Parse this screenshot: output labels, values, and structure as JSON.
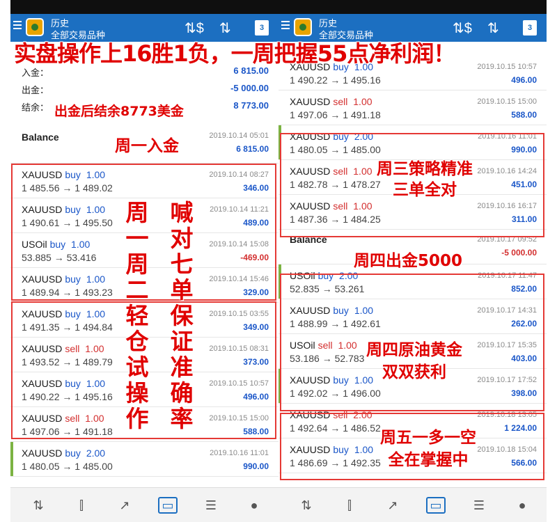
{
  "banner": "实盘操作上16胜1负，一周把握55点净利润！",
  "annotations": {
    "balance_note": "出金后结余8773美金",
    "monday_deposit": "周一入金",
    "mon_tue_col1": "周一周二轻仓试操作",
    "mon_tue_col2": "喊对七单保证准确率",
    "wednesday": "周三策略精准\n三单全对",
    "thursday_withdraw": "周四出金5000",
    "thursday_oil_gold": "周四原油黄金\n双双获利",
    "friday": "周五一多一空\n全在掌握中"
  },
  "appbar": {
    "title": "历史",
    "subtitle": "全部交易品种",
    "icon_sort_currency": "⇅$",
    "icon_sort": "⇅",
    "calendar_day": "3"
  },
  "left": {
    "summary": [
      {
        "label": "入金：",
        "value": "6 815.00"
      },
      {
        "label": "出金：",
        "value": "-5 000.00"
      },
      {
        "label": "结余：",
        "value": "8 773.00"
      }
    ],
    "balance": {
      "label": "Balance",
      "date": "2019.10.14 05:01",
      "amount": "6 815.00"
    },
    "trades": [
      {
        "symbol": "XAUUSD",
        "side": "buy",
        "lot": "1.00",
        "open": "1 485.56",
        "close": "1 489.02",
        "date": "2019.10.14 08:27",
        "profit": "346.00"
      },
      {
        "symbol": "XAUUSD",
        "side": "buy",
        "lot": "1.00",
        "open": "1 490.61",
        "close": "1 495.50",
        "date": "2019.10.14 11:21",
        "profit": "489.00"
      },
      {
        "symbol": "USOil",
        "side": "buy",
        "lot": "1.00",
        "open": "53.885",
        "close": "53.416",
        "date": "2019.10.14 15:08",
        "profit": "-469.00"
      },
      {
        "symbol": "XAUUSD",
        "side": "buy",
        "lot": "1.00",
        "open": "1 489.94",
        "close": "1 493.23",
        "date": "2019.10.14 15:46",
        "profit": "329.00"
      },
      {
        "symbol": "XAUUSD",
        "side": "buy",
        "lot": "1.00",
        "open": "1 491.35",
        "close": "1 494.84",
        "date": "2019.10.15 03:55",
        "profit": "349.00"
      },
      {
        "symbol": "XAUUSD",
        "side": "sell",
        "lot": "1.00",
        "open": "1 493.52",
        "close": "1 489.79",
        "date": "2019.10.15 08:31",
        "profit": "373.00"
      },
      {
        "symbol": "XAUUSD",
        "side": "buy",
        "lot": "1.00",
        "open": "1 490.22",
        "close": "1 495.16",
        "date": "2019.10.15 10:57",
        "profit": "496.00"
      },
      {
        "symbol": "XAUUSD",
        "side": "sell",
        "lot": "1.00",
        "open": "1 497.06",
        "close": "1 491.18",
        "date": "2019.10.15 15:00",
        "profit": "588.00"
      },
      {
        "symbol": "XAUUSD",
        "side": "buy",
        "lot": "2.00",
        "open": "1 480.05",
        "close": "1 485.00",
        "date": "2019.10.16 11:01",
        "profit": "990.00"
      }
    ]
  },
  "right": {
    "trades_top": [
      {
        "symbol": "XAUUSD",
        "side": "buy",
        "lot": "1.00",
        "open": "1 490.22",
        "close": "1 495.16",
        "date": "2019.10.15 10:57",
        "profit": "496.00"
      },
      {
        "symbol": "XAUUSD",
        "side": "sell",
        "lot": "1.00",
        "open": "1 497.06",
        "close": "1 491.18",
        "date": "2019.10.15 15:00",
        "profit": "588.00"
      },
      {
        "symbol": "XAUUSD",
        "side": "buy",
        "lot": "2.00",
        "open": "1 480.05",
        "close": "1 485.00",
        "date": "2019.10.16 11:01",
        "profit": "990.00"
      },
      {
        "symbol": "XAUUSD",
        "side": "sell",
        "lot": "1.00",
        "open": "1 482.78",
        "close": "1 478.27",
        "date": "2019.10.16 14:24",
        "profit": "451.00"
      },
      {
        "symbol": "XAUUSD",
        "side": "sell",
        "lot": "1.00",
        "open": "1 487.36",
        "close": "1 484.25",
        "date": "2019.10.16 16:17",
        "profit": "311.00"
      }
    ],
    "balance": {
      "label": "Balance",
      "date": "2019.10.17 09:52",
      "amount": "-5 000.00"
    },
    "trades_bottom": [
      {
        "symbol": "USOil",
        "side": "buy",
        "lot": "2.00",
        "open": "52.835",
        "close": "53.261",
        "date": "2019.10.17 11:47",
        "profit": "852.00"
      },
      {
        "symbol": "XAUUSD",
        "side": "buy",
        "lot": "1.00",
        "open": "1 488.99",
        "close": "1 492.61",
        "date": "2019.10.17 14:31",
        "profit": "262.00"
      },
      {
        "symbol": "USOil",
        "side": "sell",
        "lot": "1.00",
        "open": "53.186",
        "close": "52.783",
        "date": "2019.10.17 15:35",
        "profit": "403.00"
      },
      {
        "symbol": "XAUUSD",
        "side": "buy",
        "lot": "1.00",
        "open": "1 492.02",
        "close": "1 496.00",
        "date": "2019.10.17 17:52",
        "profit": "398.00"
      },
      {
        "symbol": "XAUUSD",
        "side": "sell",
        "lot": "2.00",
        "open": "1 492.64",
        "close": "1 486.52",
        "date": "2019.10.18 13:05",
        "profit": "1 224.00"
      },
      {
        "symbol": "XAUUSD",
        "side": "buy",
        "lot": "1.00",
        "open": "1 486.69",
        "close": "1 492.35",
        "date": "2019.10.18 15:04",
        "profit": "566.00"
      }
    ]
  },
  "navbar": {
    "icons": [
      "quotes-icon",
      "chart-icon",
      "trade-icon",
      "history-icon",
      "news-icon",
      "chat-icon"
    ],
    "glyphs": [
      "⇅",
      "⫿",
      "↗",
      "▭",
      "☰",
      "●"
    ],
    "active_index": 3
  },
  "colors": {
    "appbar": "#1c6fc1",
    "buy": "#1a56c8",
    "sell": "#d32f2f",
    "annotation": "#e00000"
  }
}
